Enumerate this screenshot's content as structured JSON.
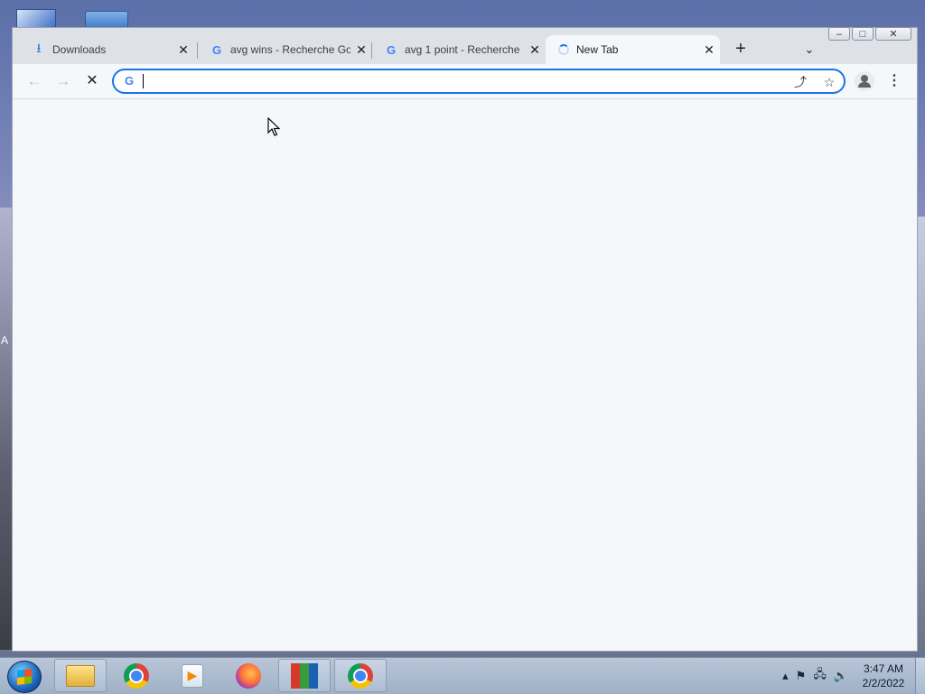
{
  "desktop": {
    "left_label": "A"
  },
  "tabs": [
    {
      "title": "Downloads",
      "icon": "download-icon",
      "active": false
    },
    {
      "title": "avg wins - Recherche Go",
      "icon": "google-icon",
      "active": false
    },
    {
      "title": "avg 1 point - Recherche",
      "icon": "google-icon",
      "active": false
    },
    {
      "title": "New Tab",
      "icon": "loading-spinner-icon",
      "active": true
    }
  ],
  "tab_close_glyph": "✕",
  "new_tab_glyph": "+",
  "tab_search_glyph": "⌄",
  "omnibox": {
    "value": "",
    "placeholder": "",
    "favicon": "G"
  },
  "taskbar": {
    "pinned": [
      "windows-explorer",
      "google-chrome",
      "media-player",
      "firefox",
      "avg",
      "google-chrome"
    ],
    "clock_time": "3:47 AM",
    "clock_date": "2/2/2022"
  },
  "colors": {
    "accent": "#1a73e8",
    "page_bg": "#f5f8fb",
    "tabstrip_bg": "#dee1e6"
  }
}
